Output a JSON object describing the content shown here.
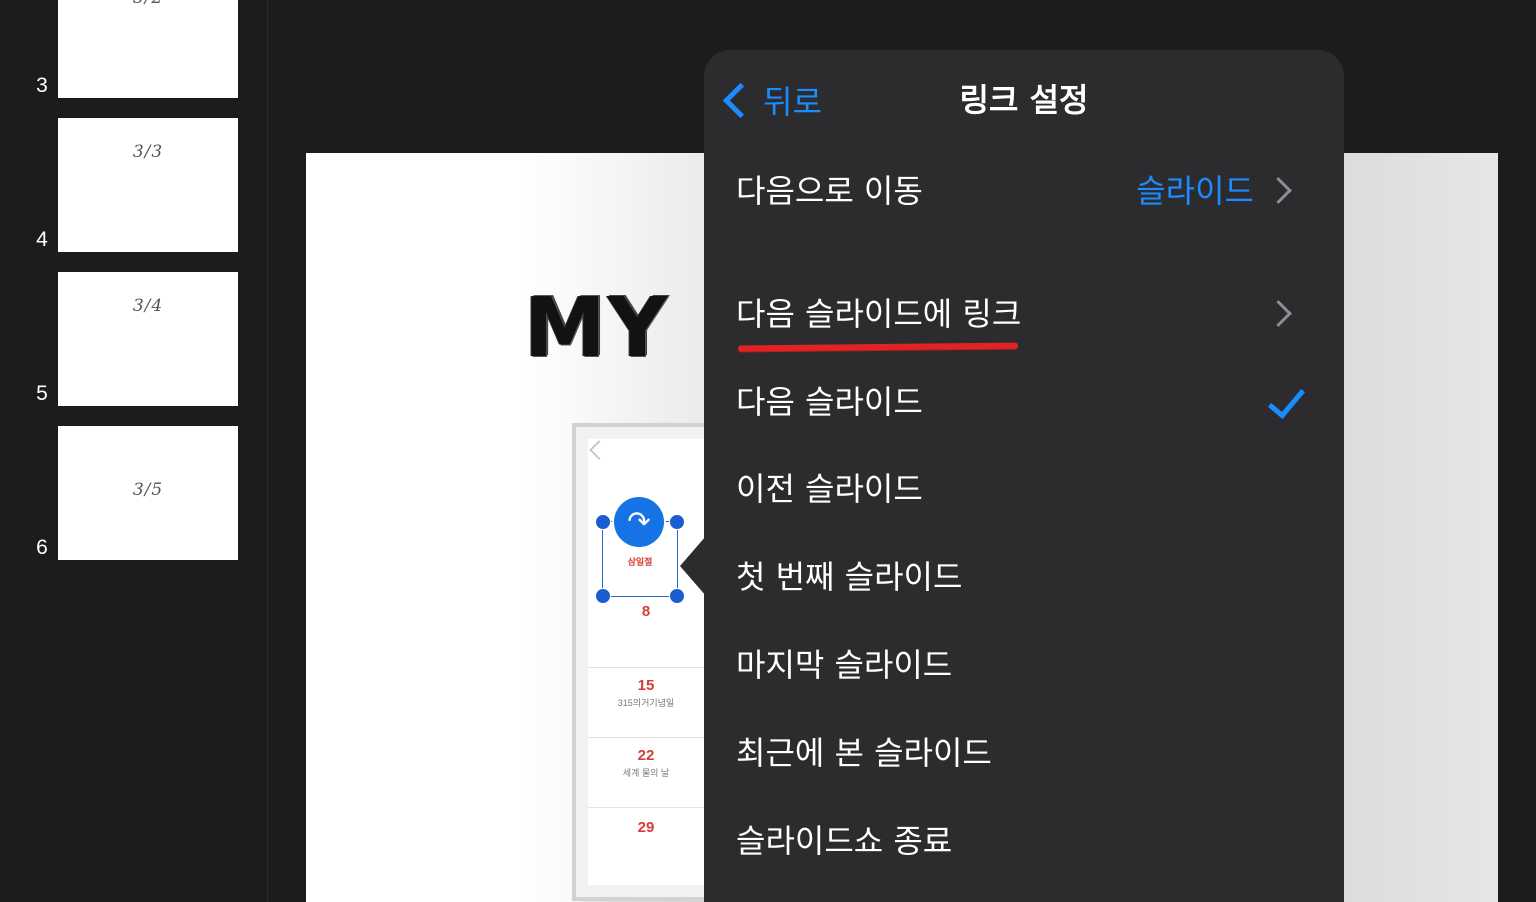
{
  "navigator": {
    "slides": [
      {
        "number": "3",
        "label": "3/2"
      },
      {
        "number": "4",
        "label": "3/3"
      },
      {
        "number": "5",
        "label": "3/4"
      },
      {
        "number": "6",
        "label": "3/5"
      }
    ]
  },
  "canvas": {
    "title_text": "MY",
    "calendar": {
      "selected_label": "삼일절",
      "cells": [
        {
          "day": "8",
          "sub": ""
        },
        {
          "day": "15",
          "sub": "315의거기념일"
        },
        {
          "day": "22",
          "sub": "세계 물의 날"
        },
        {
          "day": "29",
          "sub": ""
        }
      ]
    }
  },
  "popover": {
    "back_label": "뒤로",
    "title": "링크 설정",
    "move_label": "다음으로 이동",
    "move_value": "슬라이드",
    "link_to_slide_label": "다음 슬라이드에 링크",
    "options": [
      {
        "label": "다음 슬라이드",
        "checked": true
      },
      {
        "label": "이전 슬라이드",
        "checked": false
      },
      {
        "label": "첫 번째 슬라이드",
        "checked": false
      },
      {
        "label": "마지막 슬라이드",
        "checked": false
      },
      {
        "label": "최근에 본 슬라이드",
        "checked": false
      },
      {
        "label": "슬라이드쇼 종료",
        "checked": false
      }
    ]
  },
  "colors": {
    "accent": "#1a8cff",
    "popover_bg": "#2c2c2e",
    "app_bg": "#1c1c1e",
    "annotation_red": "#e02424"
  }
}
